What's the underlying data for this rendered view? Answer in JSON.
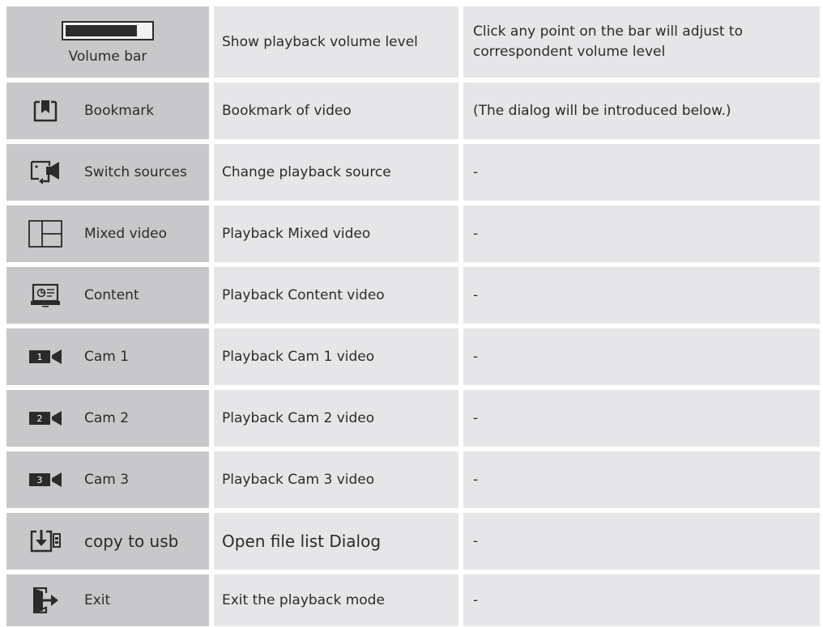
{
  "volume_bar": {
    "label": "Volume bar",
    "level": 0.85,
    "function": "Show playback volume level",
    "note": "Click any point on the bar will adjust to correspondent volume level"
  },
  "rows": [
    {
      "icon": "bookmark-icon",
      "name": "Bookmark",
      "function": "Bookmark of video",
      "note": " (The dialog will be introduced below.)"
    },
    {
      "icon": "switch-sources-icon",
      "name": "Switch sources",
      "function": "Change playback source",
      "note": "-"
    },
    {
      "icon": "mixed-video-icon",
      "name": "Mixed video",
      "function": "Playback Mixed video",
      "note": "-"
    },
    {
      "icon": "content-icon",
      "name": "Content",
      "function": "Playback Content video",
      "note": "-"
    },
    {
      "icon": "cam-1-icon",
      "name": "Cam 1",
      "function": "Playback Cam 1 video",
      "note": "-",
      "cam_number": "1"
    },
    {
      "icon": "cam-2-icon",
      "name": "Cam 2",
      "function": "Playback Cam 2 video",
      "note": "-",
      "cam_number": "2"
    },
    {
      "icon": "cam-3-icon",
      "name": "Cam 3",
      "function": "Playback Cam 3 video",
      "note": "-",
      "cam_number": "3"
    },
    {
      "icon": "copy-to-usb-icon",
      "name": "copy to usb",
      "function": "Open file list Dialog",
      "note": "-"
    },
    {
      "icon": "exit-icon",
      "name": "Exit",
      "function": "Exit the playback mode",
      "note": "-"
    }
  ],
  "colors": {
    "icon_dark": "#2b2b2b",
    "label_cell": "#c8c8ca",
    "data_cell": "#e6e6e8"
  }
}
